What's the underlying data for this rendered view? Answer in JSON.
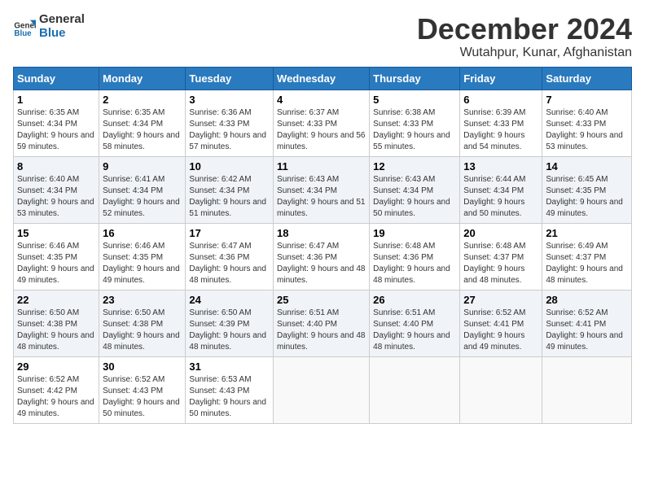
{
  "logo": {
    "line1": "General",
    "line2": "Blue"
  },
  "title": "December 2024",
  "location": "Wutahpur, Kunar, Afghanistan",
  "headers": [
    "Sunday",
    "Monday",
    "Tuesday",
    "Wednesday",
    "Thursday",
    "Friday",
    "Saturday"
  ],
  "weeks": [
    [
      {
        "day": "1",
        "sunrise": "6:35 AM",
        "sunset": "4:34 PM",
        "daylight": "9 hours and 59 minutes."
      },
      {
        "day": "2",
        "sunrise": "6:35 AM",
        "sunset": "4:34 PM",
        "daylight": "9 hours and 58 minutes."
      },
      {
        "day": "3",
        "sunrise": "6:36 AM",
        "sunset": "4:33 PM",
        "daylight": "9 hours and 57 minutes."
      },
      {
        "day": "4",
        "sunrise": "6:37 AM",
        "sunset": "4:33 PM",
        "daylight": "9 hours and 56 minutes."
      },
      {
        "day": "5",
        "sunrise": "6:38 AM",
        "sunset": "4:33 PM",
        "daylight": "9 hours and 55 minutes."
      },
      {
        "day": "6",
        "sunrise": "6:39 AM",
        "sunset": "4:33 PM",
        "daylight": "9 hours and 54 minutes."
      },
      {
        "day": "7",
        "sunrise": "6:40 AM",
        "sunset": "4:33 PM",
        "daylight": "9 hours and 53 minutes."
      }
    ],
    [
      {
        "day": "8",
        "sunrise": "6:40 AM",
        "sunset": "4:34 PM",
        "daylight": "9 hours and 53 minutes."
      },
      {
        "day": "9",
        "sunrise": "6:41 AM",
        "sunset": "4:34 PM",
        "daylight": "9 hours and 52 minutes."
      },
      {
        "day": "10",
        "sunrise": "6:42 AM",
        "sunset": "4:34 PM",
        "daylight": "9 hours and 51 minutes."
      },
      {
        "day": "11",
        "sunrise": "6:43 AM",
        "sunset": "4:34 PM",
        "daylight": "9 hours and 51 minutes."
      },
      {
        "day": "12",
        "sunrise": "6:43 AM",
        "sunset": "4:34 PM",
        "daylight": "9 hours and 50 minutes."
      },
      {
        "day": "13",
        "sunrise": "6:44 AM",
        "sunset": "4:34 PM",
        "daylight": "9 hours and 50 minutes."
      },
      {
        "day": "14",
        "sunrise": "6:45 AM",
        "sunset": "4:35 PM",
        "daylight": "9 hours and 49 minutes."
      }
    ],
    [
      {
        "day": "15",
        "sunrise": "6:46 AM",
        "sunset": "4:35 PM",
        "daylight": "9 hours and 49 minutes."
      },
      {
        "day": "16",
        "sunrise": "6:46 AM",
        "sunset": "4:35 PM",
        "daylight": "9 hours and 49 minutes."
      },
      {
        "day": "17",
        "sunrise": "6:47 AM",
        "sunset": "4:36 PM",
        "daylight": "9 hours and 48 minutes."
      },
      {
        "day": "18",
        "sunrise": "6:47 AM",
        "sunset": "4:36 PM",
        "daylight": "9 hours and 48 minutes."
      },
      {
        "day": "19",
        "sunrise": "6:48 AM",
        "sunset": "4:36 PM",
        "daylight": "9 hours and 48 minutes."
      },
      {
        "day": "20",
        "sunrise": "6:48 AM",
        "sunset": "4:37 PM",
        "daylight": "9 hours and 48 minutes."
      },
      {
        "day": "21",
        "sunrise": "6:49 AM",
        "sunset": "4:37 PM",
        "daylight": "9 hours and 48 minutes."
      }
    ],
    [
      {
        "day": "22",
        "sunrise": "6:50 AM",
        "sunset": "4:38 PM",
        "daylight": "9 hours and 48 minutes."
      },
      {
        "day": "23",
        "sunrise": "6:50 AM",
        "sunset": "4:38 PM",
        "daylight": "9 hours and 48 minutes."
      },
      {
        "day": "24",
        "sunrise": "6:50 AM",
        "sunset": "4:39 PM",
        "daylight": "9 hours and 48 minutes."
      },
      {
        "day": "25",
        "sunrise": "6:51 AM",
        "sunset": "4:40 PM",
        "daylight": "9 hours and 48 minutes."
      },
      {
        "day": "26",
        "sunrise": "6:51 AM",
        "sunset": "4:40 PM",
        "daylight": "9 hours and 48 minutes."
      },
      {
        "day": "27",
        "sunrise": "6:52 AM",
        "sunset": "4:41 PM",
        "daylight": "9 hours and 49 minutes."
      },
      {
        "day": "28",
        "sunrise": "6:52 AM",
        "sunset": "4:41 PM",
        "daylight": "9 hours and 49 minutes."
      }
    ],
    [
      {
        "day": "29",
        "sunrise": "6:52 AM",
        "sunset": "4:42 PM",
        "daylight": "9 hours and 49 minutes."
      },
      {
        "day": "30",
        "sunrise": "6:52 AM",
        "sunset": "4:43 PM",
        "daylight": "9 hours and 50 minutes."
      },
      {
        "day": "31",
        "sunrise": "6:53 AM",
        "sunset": "4:43 PM",
        "daylight": "9 hours and 50 minutes."
      },
      null,
      null,
      null,
      null
    ]
  ]
}
